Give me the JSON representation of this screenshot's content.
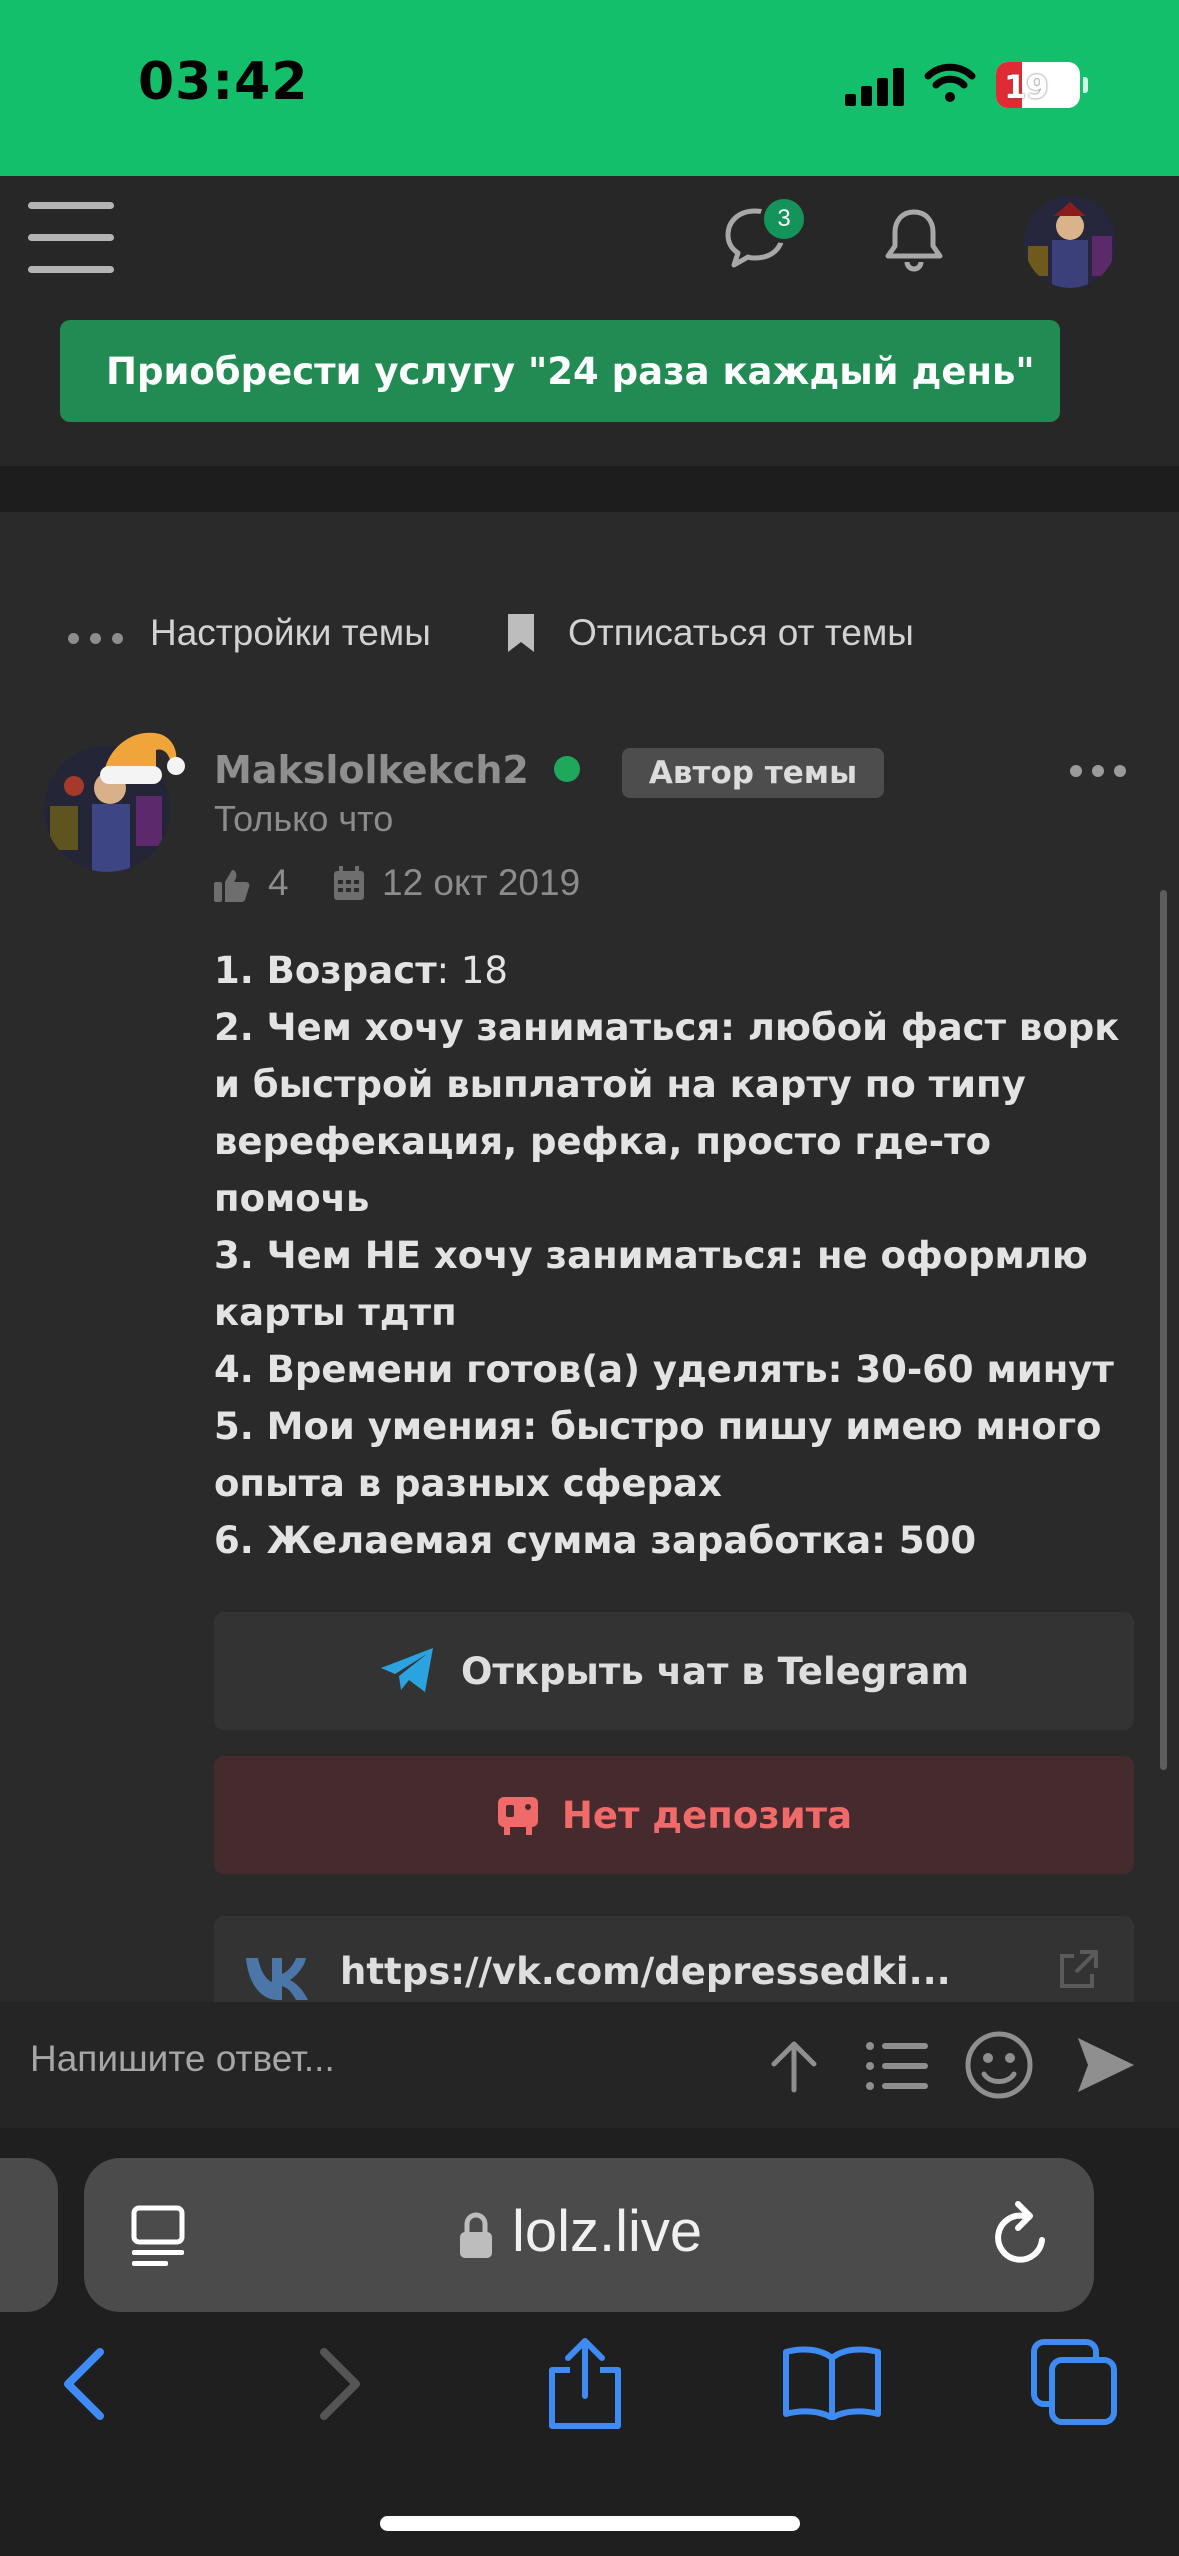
{
  "status_bar": {
    "time": "03:42",
    "battery": "19"
  },
  "header": {
    "messages_count": "3"
  },
  "promo": {
    "label": "Приобрести услугу \"24 раза каждый день\""
  },
  "thread_options": {
    "settings": "Настройки темы",
    "unsubscribe": "Отписаться от темы"
  },
  "post": {
    "username": "Makslolkekch2",
    "author_badge": "Автор темы",
    "time": "Только что",
    "likes": "4",
    "joined": "12 окт 2019",
    "lines": [
      {
        "label": "1. Возраст",
        "value": ": 18"
      },
      {
        "label": "2. Чем хочу заниматься: любой фаст ворк и быстрой выплатой на карту по типу верефекация, рефка, просто где-то помочь",
        "value": ""
      },
      {
        "label": "3. Чем НЕ хочу заниматься: не оформлю карты тдтп",
        "value": ""
      },
      {
        "label": "4. Времени готов(а) уделять: 30-60 минут",
        "value": ""
      },
      {
        "label": "5. Мои умения: быстро пишу имею много опыта в разных сферах",
        "value": ""
      },
      {
        "label": "6. Желаемая сумма заработка: 500",
        "value": ""
      }
    ],
    "telegram_button": "Открыть чат в Telegram",
    "deposit_button": "Нет депозита",
    "vk_link": "https://vk.com/depressedki..."
  },
  "reply": {
    "placeholder": "Напишите ответ..."
  },
  "browser": {
    "url": "lolz.live"
  },
  "colors": {
    "accent": "#13bf6b",
    "promo": "#228b54",
    "deposit_text": "#f06a6a",
    "telegram": "#2aa3e0",
    "vk": "#4a76a8",
    "ios_blue": "#3e8bf3"
  }
}
